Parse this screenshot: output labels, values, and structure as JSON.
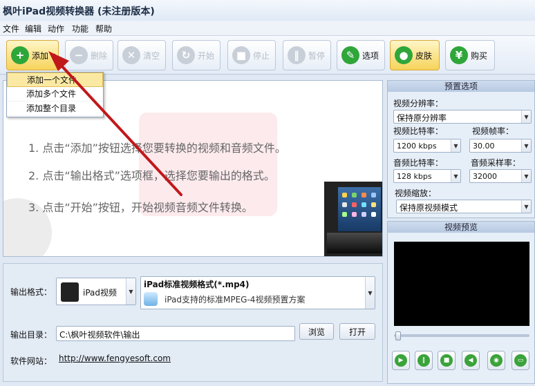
{
  "app": {
    "title": "枫叶iPad视频转换器  (未注册版本)"
  },
  "menu": [
    {
      "label": "文件"
    },
    {
      "label": "编辑"
    },
    {
      "label": "动作"
    },
    {
      "label": "功能"
    },
    {
      "label": "帮助"
    }
  ],
  "toolbar": {
    "add": "添加",
    "delete": "删除",
    "clear": "清空",
    "start": "开始",
    "stop": "停止",
    "pause": "暂停",
    "options": "选项",
    "skin": "皮肤",
    "buy": "购买"
  },
  "add_menu": [
    {
      "label": "添加一个文件"
    },
    {
      "label": "添加多个文件"
    },
    {
      "label": "添加整个目录"
    }
  ],
  "instructions": [
    "1. 点击“添加”按钮选择您要转换的视频和音频文件。",
    "2. 点击“输出格式”选项框，选择您要输出的格式。",
    "3. 点击“开始”按钮，开始视频音频文件转换。"
  ],
  "output": {
    "format_label": "输出格式：",
    "device": "iPad视频",
    "format_name": "iPad标准视频格式(*.mp4)",
    "format_desc": "iPad支持的标准MPEG-4视频预置方案",
    "dir_label": "输出目录：",
    "dir_value": "C:\\枫叶视频软件\\输出",
    "browse": "浏览",
    "open": "打开",
    "site_label": "软件网站：",
    "site_url": "http://www.fengyesoft.com"
  },
  "presets": {
    "title": "预置选项",
    "resolution_label": "视频分辨率：",
    "resolution_value": "保持原分辨率",
    "vbitrate_label": "视频比特率：",
    "vbitrate_value": "1200 kbps",
    "framerate_label": "视频帧率：",
    "framerate_value": "30.00",
    "abitrate_label": "音频比特率：",
    "abitrate_value": "128 kbps",
    "samplerate_label": "音频采样率：",
    "samplerate_value": "32000",
    "scale_label": "视频缩放：",
    "scale_value": "保持原视频模式"
  },
  "preview": {
    "title": "视频预览"
  },
  "colors": {
    "accent_green": "#3aa33a",
    "annotation_arrow": "#c0181b",
    "highlight": "#f6d35a"
  }
}
